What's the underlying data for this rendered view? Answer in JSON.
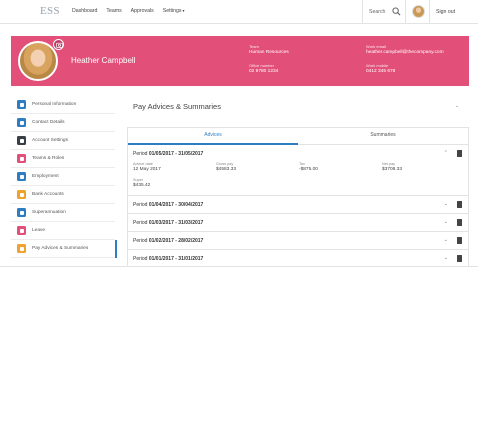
{
  "app": {
    "logo": "ESS"
  },
  "nav": {
    "dashboard": "Dashboard",
    "teams": "Teams",
    "approvals": "Approvals",
    "settings": "Settings",
    "settings_caret": "▾"
  },
  "header": {
    "search_label": "Search",
    "sign_out": "Sign out"
  },
  "profile": {
    "name": "Heather Campbell",
    "team_label": "Team",
    "team": "Human Resources",
    "office_label": "Office number",
    "office": "02 9780 1234",
    "email_label": "Work email",
    "email": "heather.campbell@thecompany.com",
    "mobile_label": "Work mobile",
    "mobile": "0412 345 678"
  },
  "sidebar": {
    "items": [
      {
        "label": "Personal Information",
        "color": "#2f7dc1"
      },
      {
        "label": "Contact Details",
        "color": "#2f7dc1"
      },
      {
        "label": "Account Settings",
        "color": "#3a3f47"
      },
      {
        "label": "Teams & Roles",
        "color": "#e2507a"
      },
      {
        "label": "Employment",
        "color": "#2f7dc1"
      },
      {
        "label": "Bank Accounts",
        "color": "#f0a22e"
      },
      {
        "label": "Superannuation",
        "color": "#2f7dc1"
      },
      {
        "label": "Leave",
        "color": "#e2507a"
      },
      {
        "label": "Pay Advices & Summaries",
        "color": "#f0a22e"
      }
    ]
  },
  "main": {
    "title": "Pay Advices & Summaries",
    "tabs": {
      "advices": "Advices",
      "summaries": "Summaries"
    },
    "open_period": {
      "prefix": "Period",
      "range": "01/05/2017 - 31/05/2017",
      "advice_date_label": "Advice date",
      "advice_date": "12 May 2017",
      "gross_label": "Gross pay",
      "gross": "$4583.33",
      "tax_label": "Tax",
      "tax": "-$875.00",
      "net_label": "Net pay",
      "net": "$3708.33",
      "super_label": "Super",
      "super": "$435.42"
    },
    "periods": [
      {
        "prefix": "Period",
        "range": "01/04/2017 - 30/04/2017"
      },
      {
        "prefix": "Period",
        "range": "01/03/2017 - 31/03/2017"
      },
      {
        "prefix": "Period",
        "range": "01/02/2017 - 28/02/2017"
      },
      {
        "prefix": "Period",
        "range": "01/01/2017 - 31/01/2017"
      }
    ],
    "chevron_up": "⌃",
    "chevron_down": "⌄"
  },
  "colors": {
    "accent": "#2f7dc1",
    "profile_bg": "#e2507a"
  }
}
